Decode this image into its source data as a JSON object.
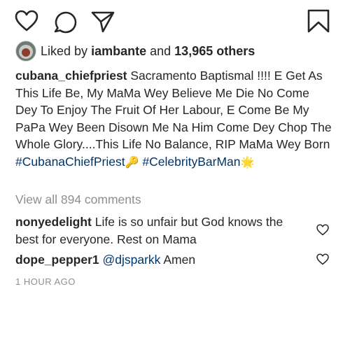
{
  "actions": {
    "like_icon": "heart-outline",
    "comment_icon": "speech-bubble",
    "share_icon": "paper-plane",
    "save_icon": "bookmark-outline"
  },
  "likes": {
    "prefix": "Liked by",
    "user": "iambante",
    "conjunction": "and",
    "others": "13,965 others"
  },
  "caption": {
    "username": "cubana_chiefpriest",
    "text": "Sacramento Baptismal !!!! E Get As This Life Be, My MaMa Wey Believe Me Die No Come Dey To Enjoy The Fruit Of Her Labour, E Come Be My PaPa Wey Been Disown Me Na Him Come Dey Chop The Whole Glory....This Life No Balance, RIP MaMa Wey Born",
    "hashtag1": "#CubanaChiefPriest",
    "emoji1": "🔑",
    "hashtag2": "#CelebrityBarMan",
    "emoji2": "🌟"
  },
  "view_all": "View all 894 comments",
  "comments": [
    {
      "username": "nonyedelight",
      "text": "Life is so unfair but God knows the best for everyone. Rest on Mama"
    },
    {
      "username": "dope_pepper1",
      "mention": "@djsparkk",
      "text": "Amen"
    }
  ],
  "timestamp": "1 HOUR AGO",
  "colors": {
    "text": "#262626",
    "link": "#003569",
    "muted": "#8e8e8e"
  }
}
